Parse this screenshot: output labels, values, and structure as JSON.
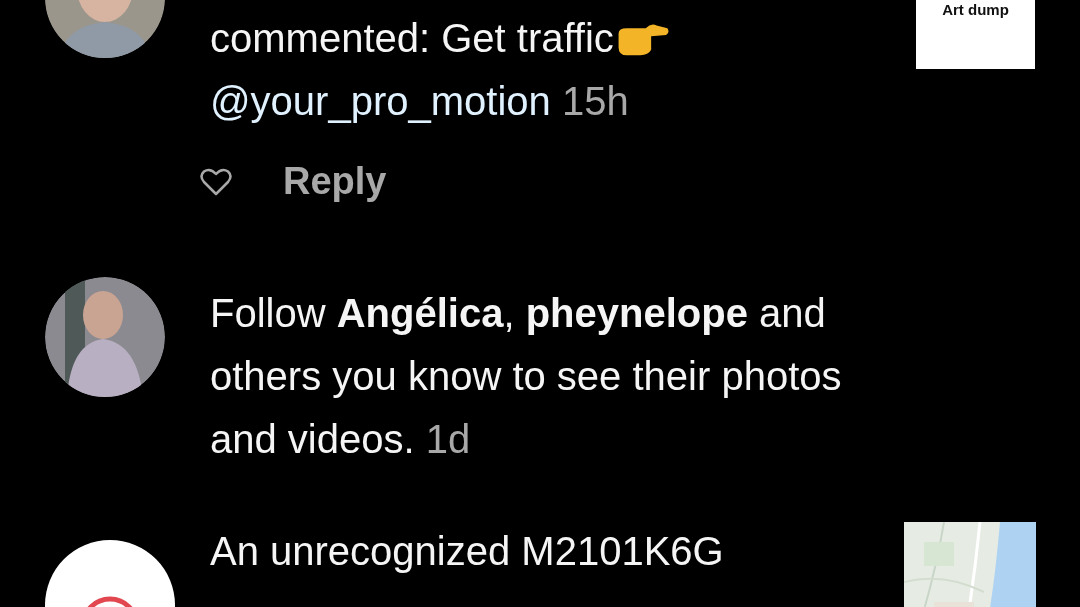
{
  "notifications": [
    {
      "kind": "comment",
      "text": "commented: Get traffic",
      "mention": "@your_pro_motion",
      "time": "15h",
      "liked": false,
      "reply": "Reply",
      "thumbnail": {
        "kind": "text",
        "text": "Art dump"
      }
    },
    {
      "kind": "follow",
      "text": "Follow **Angélica**, **pheynelope** and others you know to see their photos and videos.",
      "time": "1d"
    },
    {
      "kind": "login",
      "text": "An unrecognized M2101K6G"
    }
  ]
}
